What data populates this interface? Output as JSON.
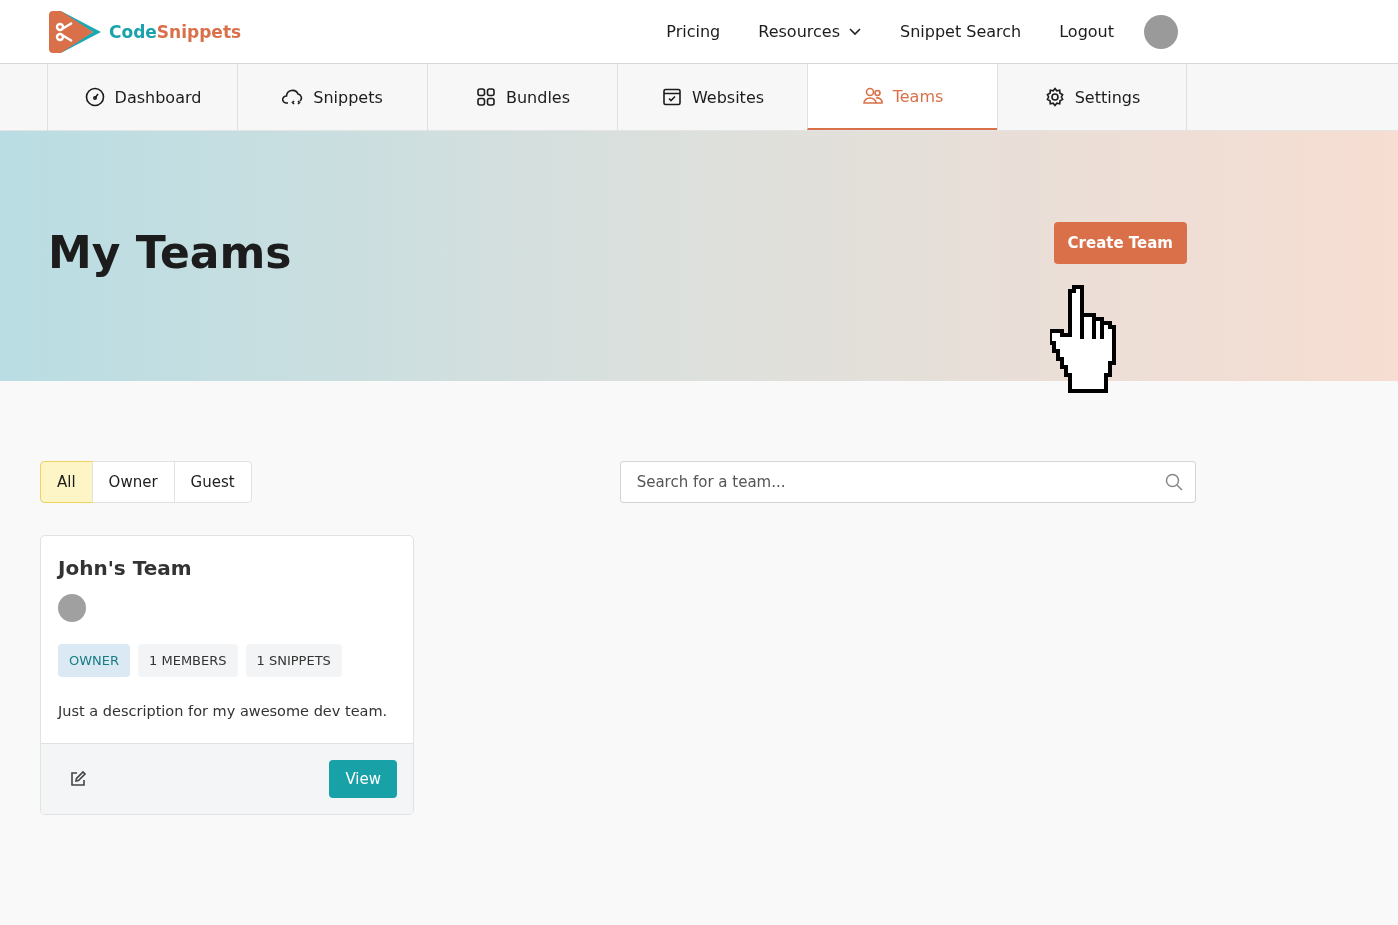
{
  "logo": {
    "part_1": "Code",
    "part_2": "Snippets"
  },
  "top_nav": [
    {
      "label": "Pricing",
      "kind": "link"
    },
    {
      "label": "Resources",
      "kind": "dropdown"
    },
    {
      "label": "Snippet Search",
      "kind": "link"
    },
    {
      "label": "Logout",
      "kind": "link"
    }
  ],
  "tabs": [
    {
      "label": "Dashboard",
      "kind": "dashboard",
      "selected": false
    },
    {
      "label": "Snippets",
      "kind": "snippets",
      "selected": false
    },
    {
      "label": "Bundles",
      "kind": "bundles",
      "selected": false
    },
    {
      "label": "Websites",
      "kind": "websites",
      "selected": false
    },
    {
      "label": "Teams",
      "kind": "teams",
      "selected": true
    },
    {
      "label": "Settings",
      "kind": "settings",
      "selected": false
    }
  ],
  "hero": {
    "title": "My Teams",
    "button": "Create Team"
  },
  "filters": [
    {
      "label": "All",
      "selected": true
    },
    {
      "label": "Owner",
      "selected": false
    },
    {
      "label": "Guest",
      "selected": false
    }
  ],
  "search": {
    "placeholder": "Search for a team..."
  },
  "teams": [
    {
      "name": "John's Team",
      "badges": [
        {
          "label": "OWNER",
          "kind": "role"
        },
        {
          "label": "1 MEMBERS",
          "kind": "count"
        },
        {
          "label": "1 SNIPPETS",
          "kind": "count"
        }
      ],
      "description": "Just a description for my awesome dev team.",
      "button": "View"
    }
  ]
}
